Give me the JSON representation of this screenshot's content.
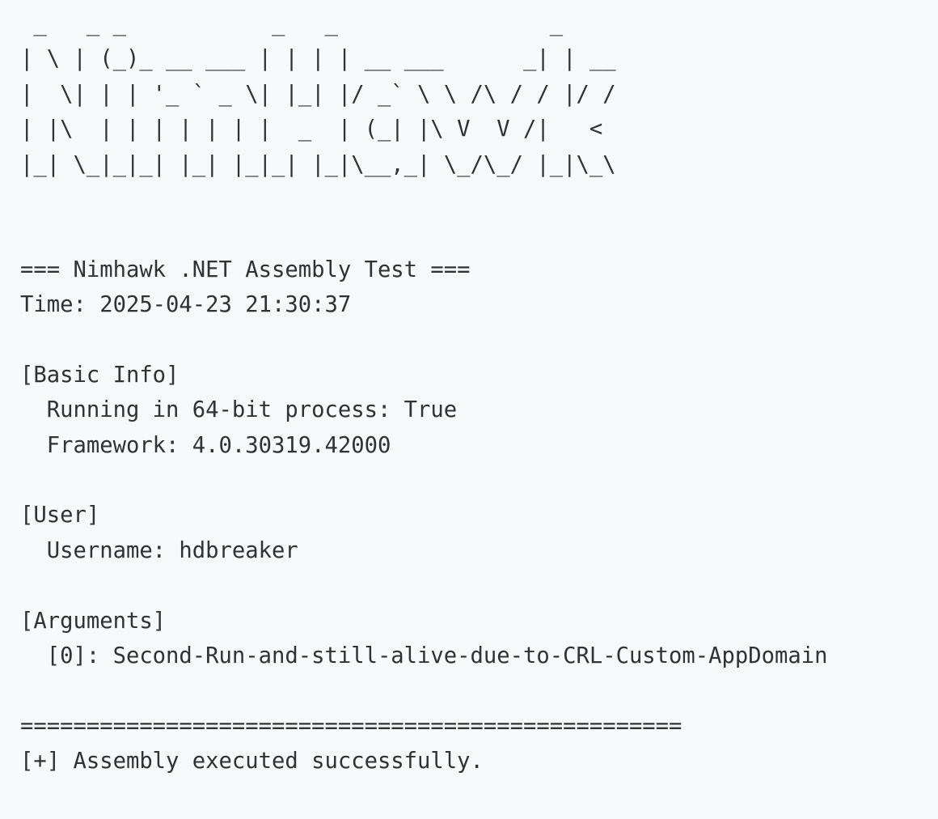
{
  "terminal": {
    "lines": [
      " _   _ _           _   _                _    ",
      "| \\ | (_)_ __ ___ | | | | __ ___      _| | __",
      "|  \\| | | '_ ` _ \\| |_| |/ _` \\ \\ /\\ / / |/ /",
      "| |\\  | | | | | | |  _  | (_| |\\ V  V /|   < ",
      "|_| \\_|_|_| |_| |_|_| |_|\\__,_| \\_/\\_/ |_|\\_\\",
      "",
      "",
      "=== Nimhawk .NET Assembly Test ===",
      "Time: 2025-04-23 21:30:37",
      "",
      "[Basic Info]",
      "  Running in 64-bit process: True",
      "  Framework: 4.0.30319.42000",
      "",
      "[User]",
      "  Username: hdbreaker",
      "",
      "[Arguments]",
      "  [0]: Second-Run-and-still-alive-due-to-CRL-Custom-AppDomain",
      "",
      "==================================================",
      "[+] Assembly executed successfully."
    ]
  }
}
